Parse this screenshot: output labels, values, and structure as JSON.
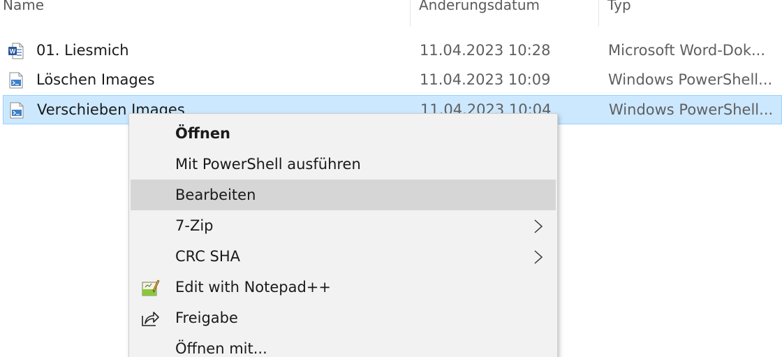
{
  "columns": {
    "name": "Name",
    "date": "Änderungsdatum",
    "type": "Typ"
  },
  "files": [
    {
      "name": "01. Liesmich",
      "date": "11.04.2023 10:28",
      "type": "Microsoft Word-Dok...",
      "icon": "word-document-icon"
    },
    {
      "name": "Löschen Images",
      "date": "11.04.2023 10:09",
      "type": "Windows PowerShell...",
      "icon": "powershell-script-icon"
    },
    {
      "name": "Verschieben Images",
      "date": "11.04.2023 10:04",
      "type": "Windows PowerShell...",
      "icon": "powershell-script-icon",
      "selected": true
    }
  ],
  "context_menu": {
    "items": [
      {
        "label": "Öffnen",
        "bold": true
      },
      {
        "label": "Mit PowerShell ausführen"
      },
      {
        "label": "Bearbeiten",
        "hover": true
      },
      {
        "label": "7-Zip",
        "submenu": true
      },
      {
        "label": "CRC SHA",
        "submenu": true
      },
      {
        "label": "Edit with Notepad++",
        "icon": "notepad-plus-plus-icon"
      },
      {
        "label": "Freigabe",
        "icon": "share-icon"
      },
      {
        "label": "Öffnen mit..."
      }
    ]
  },
  "colors": {
    "selection_bg": "#cce8ff",
    "selection_border": "#99d1ff",
    "menu_bg": "#f2f2f2",
    "menu_hover": "#d6d6d6",
    "word_blue": "#2b579a"
  }
}
